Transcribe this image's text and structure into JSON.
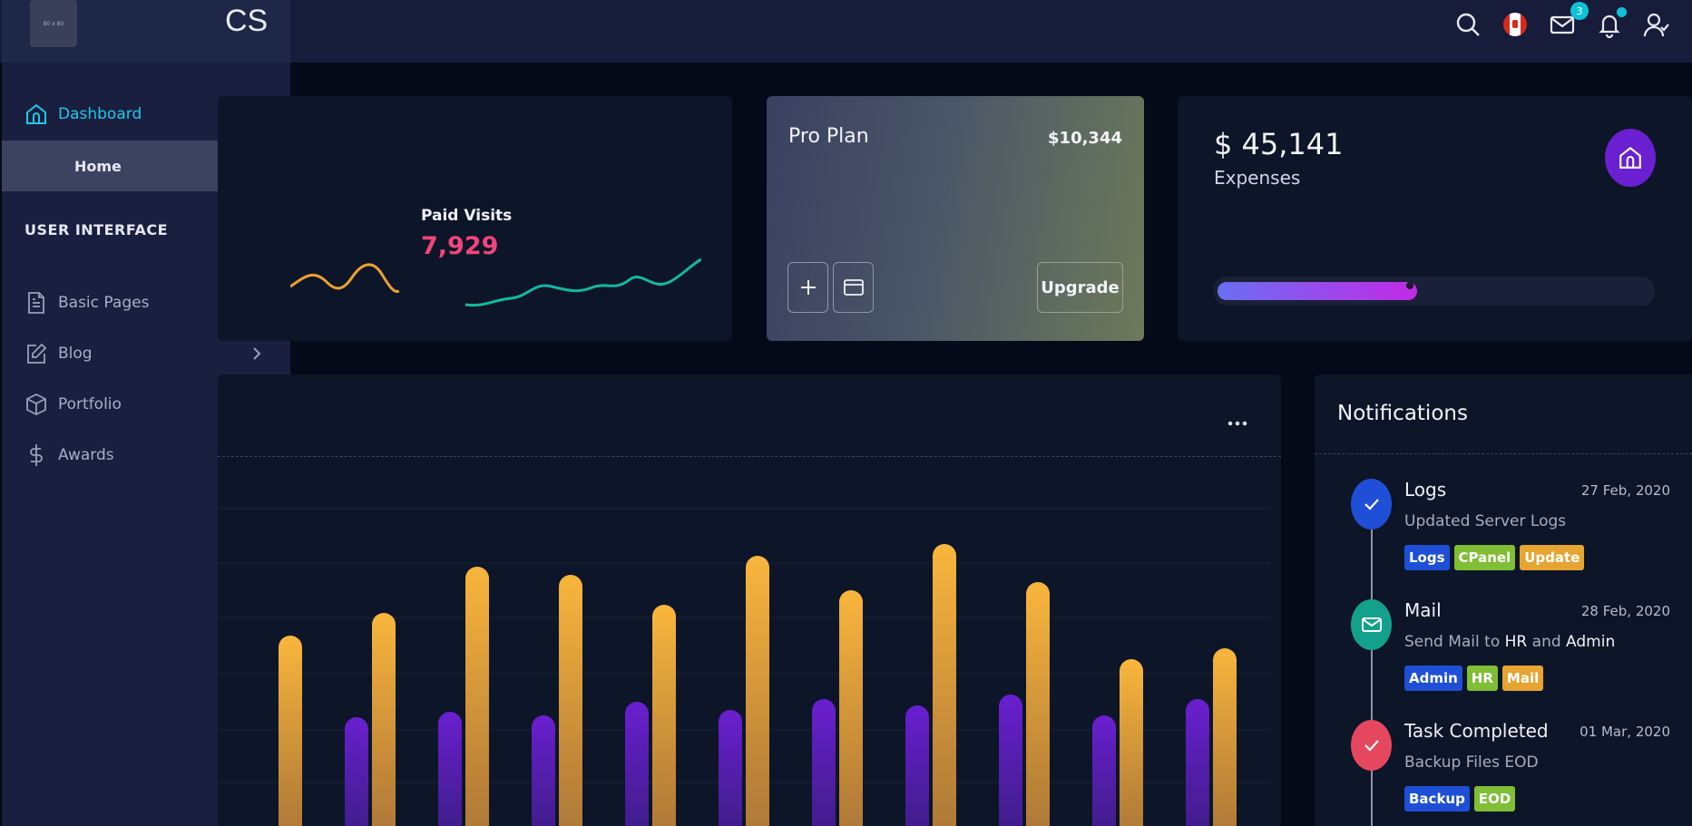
{
  "brand": {
    "logo_text": "80 x 80",
    "name": "CS"
  },
  "topbar": {
    "mail_count": "3"
  },
  "sidebar": {
    "dashboard": "Dashboard",
    "home": "Home",
    "section": "USER INTERFACE",
    "items": [
      {
        "label": "Basic Pages"
      },
      {
        "label": "Blog"
      },
      {
        "label": "Portfolio"
      },
      {
        "label": "Awards"
      }
    ]
  },
  "visits": {
    "label": "Paid Visits",
    "value": "7,929"
  },
  "plan": {
    "title": "Pro Plan",
    "price": "$10,344",
    "upgrade": "Upgrade"
  },
  "expenses": {
    "amount": "$ 45,141",
    "label": "Expenses",
    "progress": 0.46,
    "bar_color_start": "#6a6ff2",
    "bar_color_end": "#c22ae6"
  },
  "chart_data": {
    "type": "bar",
    "series": [
      {
        "color": "#6a1fd0",
        "values": [
          null,
          120,
          126,
          122,
          137,
          128,
          140,
          133,
          145,
          122,
          140
        ]
      },
      {
        "color": "#f7b23b",
        "values": [
          210,
          235,
          286,
          277,
          244,
          298,
          260,
          311,
          269,
          184,
          196
        ]
      }
    ]
  },
  "notifications": {
    "title": "Notifications",
    "items": [
      {
        "title": "Logs",
        "date": "27 Feb, 2020",
        "desc": "Updated Server Logs",
        "tags": [
          "Logs",
          "CPanel",
          "Update"
        ]
      },
      {
        "title": "Mail",
        "date": "28 Feb, 2020",
        "desc_pre": "Send Mail to",
        "desc_hr": "HR",
        "desc_and": "and",
        "desc_admin": "Admin",
        "tags": [
          "Admin",
          "HR",
          "Mail"
        ]
      },
      {
        "title": "Task Completed",
        "date": "01 Mar, 2020",
        "desc": "Backup Files EOD",
        "tags": [
          "Backup",
          "EOD"
        ]
      }
    ]
  }
}
